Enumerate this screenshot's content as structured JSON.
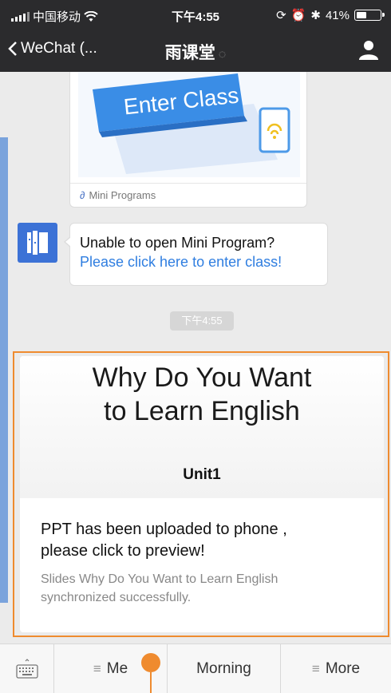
{
  "status": {
    "carrier": "中国移动",
    "time": "下午4:55",
    "battery_pct": "41%",
    "icons": [
      "signal-icon",
      "wifi-icon",
      "rotation-lock-icon",
      "alarm-icon",
      "bluetooth-icon",
      "battery-icon"
    ]
  },
  "nav": {
    "back_label": "WeChat (...",
    "title": "雨课堂",
    "right_icon": "person-icon"
  },
  "mini_program": {
    "banner_text": "Enter Class",
    "footer_label": "Mini Programs"
  },
  "message": {
    "line1": "Unable to open Mini Program?",
    "link": "Please click here to enter class!"
  },
  "timestamp": "下午4:55",
  "slide": {
    "title_line1": "Why Do You Want",
    "title_line2": "to Learn English",
    "unit": "Unit1",
    "text_line1": "PPT has been uploaded to phone ,",
    "text_line2": "please click to preview!",
    "desc_line1": "Slides Why Do You Want to Learn English",
    "desc_line2": "synchronized successfully."
  },
  "bottom_menu": [
    {
      "label": "Me"
    },
    {
      "label": "Morning"
    },
    {
      "label": "More"
    }
  ],
  "colors": {
    "nav_bg": "#2b2b2d",
    "highlight": "#ef8b2f",
    "link": "#2f7ee0",
    "avatar": "#3c72d6"
  }
}
